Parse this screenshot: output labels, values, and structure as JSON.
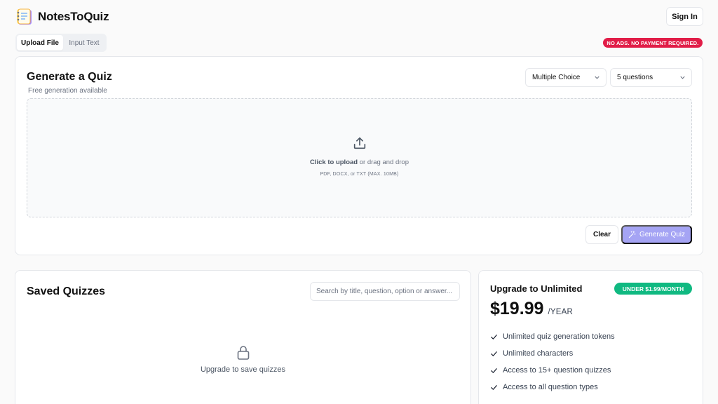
{
  "header": {
    "app_name": "NotesToQuiz",
    "sign_in_label": "Sign In"
  },
  "tabs": [
    {
      "label": "Upload File",
      "active": true
    },
    {
      "label": "Input Text",
      "active": false
    }
  ],
  "promo_badge": "NO ADS. NO PAYMENT REQUIRED.",
  "generate": {
    "title": "Generate a Quiz",
    "subtitle": "Free generation available",
    "question_type": "Multiple Choice",
    "question_count": "5 questions",
    "upload_prompt_bold": "Click to upload",
    "upload_prompt_rest": " or drag and drop",
    "upload_hint": "PDF, DOCX, or TXT (MAX. 10MB)",
    "clear_label": "Clear",
    "generate_label": "Generate Quiz"
  },
  "saved": {
    "title": "Saved Quizzes",
    "search_placeholder": "Search by title, question, option or answer...",
    "empty_message": "Upgrade to save quizzes"
  },
  "upgrade": {
    "title": "Upgrade to Unlimited",
    "badge": "UNDER $1.99/MONTH",
    "price": "$19.99",
    "period": "/YEAR",
    "features": [
      "Unlimited quiz generation tokens",
      "Unlimited characters",
      "Access to 15+ question quizzes",
      "Access to all question types"
    ]
  },
  "colors": {
    "promo_badge": "#e11d48",
    "upgrade_badge": "#10b981",
    "generate_button": "#a5a4f4"
  }
}
